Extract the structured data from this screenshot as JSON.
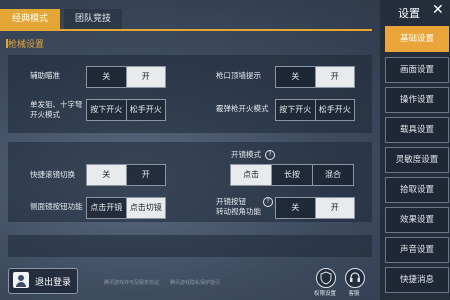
{
  "top_tabs": [
    "经典模式",
    "团队竞技"
  ],
  "section_title": "枪械设置",
  "rows": {
    "aim_assist": {
      "label": "辅助瞄准",
      "options": [
        "关",
        "开"
      ],
      "selected": 1
    },
    "muzzle_hint": {
      "label": "枪口顶墙提示",
      "options": [
        "关",
        "开"
      ],
      "selected": 1
    },
    "single_fire": {
      "label_line1": "单发狙、十字弩",
      "label_line2": "开火模式",
      "options": [
        "按下开火",
        "松手开火"
      ],
      "selected": -1
    },
    "shotgun_fire": {
      "label": "霰弹枪开火模式",
      "options": [
        "按下开火",
        "松手开火"
      ],
      "selected": -1
    },
    "quick_scope": {
      "label": "快捷滚镜切换",
      "options": [
        "关",
        "开"
      ],
      "selected": 0
    },
    "scope_mode": {
      "label": "开镜模式",
      "options": [
        "点击",
        "长按",
        "混合"
      ],
      "selected": 0
    },
    "side_scope_btn": {
      "label": "侧面镜按钮功能",
      "options": [
        "点击开镜",
        "点击切镜"
      ],
      "selected": 1
    },
    "scope_rotate": {
      "label_line1": "开镜按钮",
      "label_line2": "转动视角功能",
      "options": [
        "关",
        "开"
      ],
      "selected": 1
    }
  },
  "help_glyph": "?",
  "logout_label": "退出登录",
  "fine_print": [
    "腾讯游戏许可及服务协议",
    "腾讯游戏隐私保护指引"
  ],
  "bottom_buttons": [
    "权限设置",
    "客服"
  ],
  "sidebar": {
    "title": "设置",
    "close": "✕",
    "items": [
      "基础设置",
      "画面设置",
      "操作设置",
      "载具设置",
      "灵敏度设置",
      "拾取设置",
      "效果设置",
      "声音设置",
      "快捷消息"
    ],
    "active": 0
  }
}
